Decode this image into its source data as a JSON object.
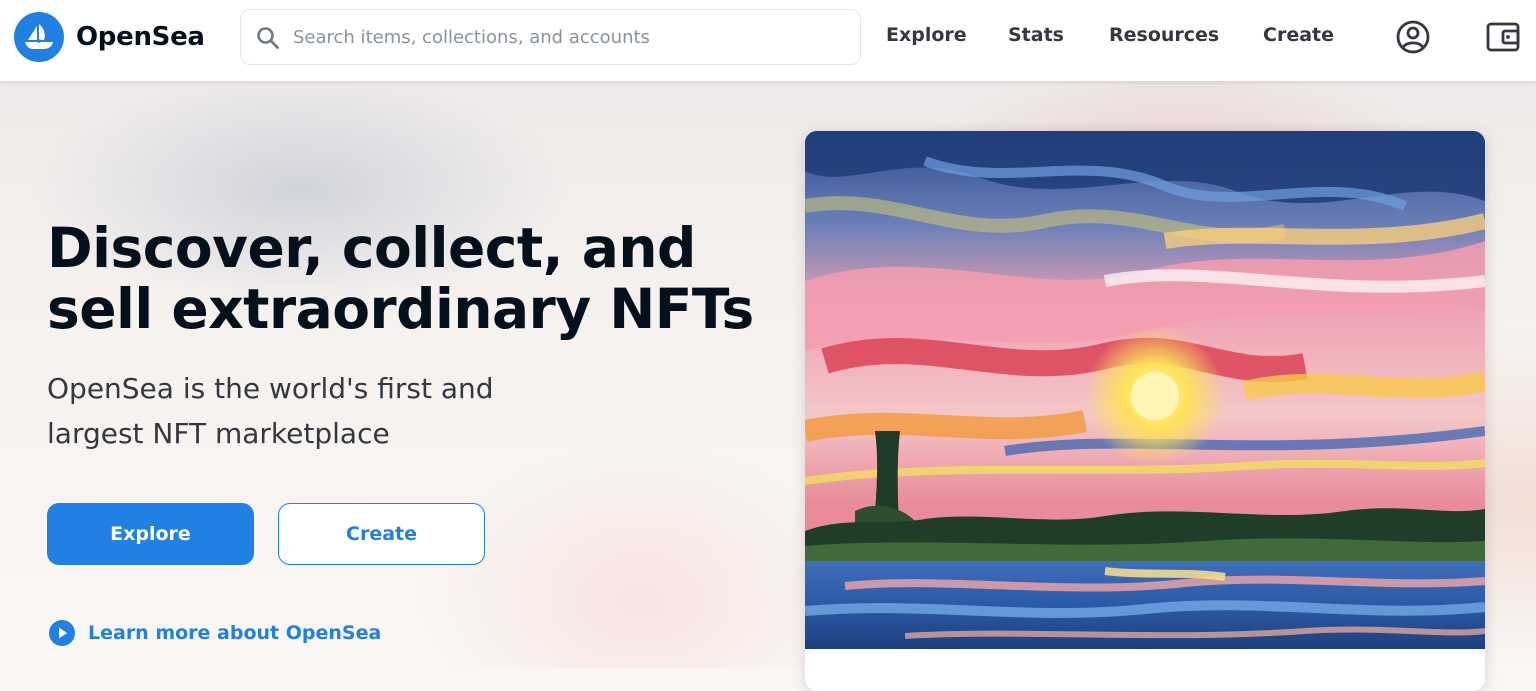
{
  "header": {
    "brand": "OpenSea",
    "logo_icon": "opensea-boat-icon",
    "search": {
      "placeholder": "Search items, collections, and accounts",
      "value": ""
    },
    "nav": [
      {
        "label": "Explore"
      },
      {
        "label": "Stats"
      },
      {
        "label": "Resources"
      },
      {
        "label": "Create"
      }
    ],
    "icons": [
      "account-icon",
      "wallet-icon"
    ]
  },
  "hero": {
    "title_line1": "Discover, collect, and",
    "title_line2": "sell extraordinary NFTs",
    "subtitle_line1": "OpenSea is the world's first and",
    "subtitle_line2": "largest NFT marketplace",
    "primary_button": "Explore",
    "secondary_button": "Create",
    "learn_more": "Learn more about OpenSea"
  },
  "colors": {
    "accent": "#2081e2",
    "text_primary": "#04111d",
    "text_secondary": "#353840",
    "placeholder": "#8a939b"
  }
}
